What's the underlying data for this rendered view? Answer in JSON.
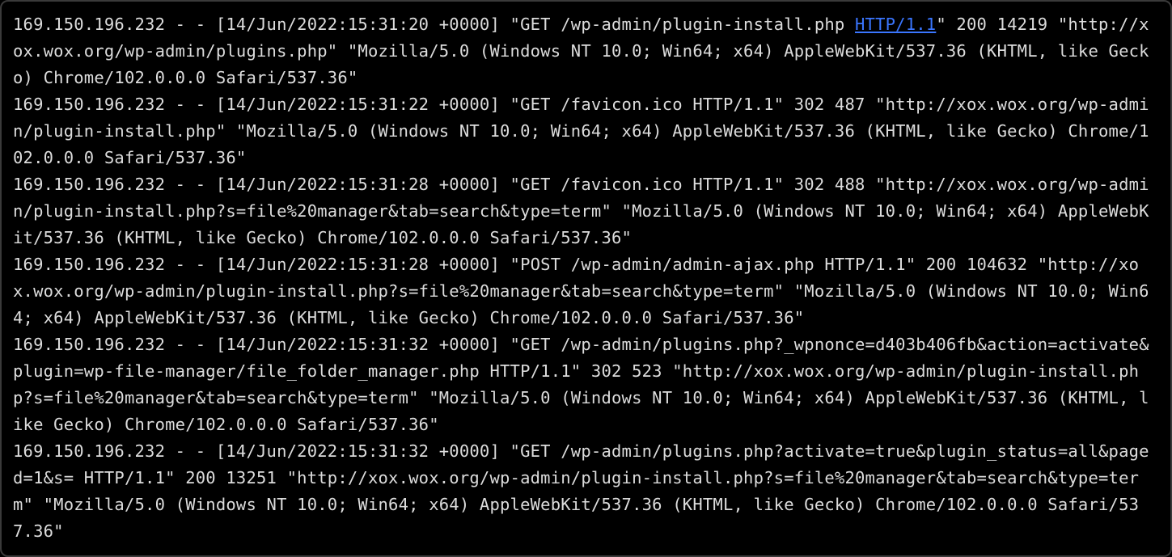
{
  "log": {
    "entries": [
      {
        "pre": "169.150.196.232 - - [14/Jun/2022:15:31:20 +0000] \"GET /wp-admin/plugin-install.php ",
        "link": "HTTP/1.1",
        "post": "\" 200 14219 \"http://xox.wox.org/wp-admin/plugins.php\" \"Mozilla/5.0 (Windows NT 10.0; Win64; x64) AppleWebKit/537.36 (KHTML, like Gecko) Chrome/102.0.0.0 Safari/537.36\""
      },
      {
        "pre": "169.150.196.232 - - [14/Jun/2022:15:31:22 +0000] \"GET /favicon.ico HTTP/1.1\" 302 487 \"http://xox.wox.org/wp-admin/plugin-install.php\" \"Mozilla/5.0 (Windows NT 10.0; Win64; x64) AppleWebKit/537.36 (KHTML, like Gecko) Chrome/102.0.0.0 Safari/537.36\"",
        "link": "",
        "post": ""
      },
      {
        "pre": "169.150.196.232 - - [14/Jun/2022:15:31:28 +0000] \"GET /favicon.ico HTTP/1.1\" 302 488 \"http://xox.wox.org/wp-admin/plugin-install.php?s=file%20manager&tab=search&type=term\" \"Mozilla/5.0 (Windows NT 10.0; Win64; x64) AppleWebKit/537.36 (KHTML, like Gecko) Chrome/102.0.0.0 Safari/537.36\"",
        "link": "",
        "post": ""
      },
      {
        "pre": "169.150.196.232 - - [14/Jun/2022:15:31:28 +0000] \"POST /wp-admin/admin-ajax.php HTTP/1.1\" 200 104632 \"http://xox.wox.org/wp-admin/plugin-install.php?s=file%20manager&tab=search&type=term\" \"Mozilla/5.0 (Windows NT 10.0; Win64; x64) AppleWebKit/537.36 (KHTML, like Gecko) Chrome/102.0.0.0 Safari/537.36\"",
        "link": "",
        "post": ""
      },
      {
        "pre": "169.150.196.232 - - [14/Jun/2022:15:31:32 +0000] \"GET /wp-admin/plugins.php?_wpnonce=d403b406fb&action=activate&plugin=wp-file-manager/file_folder_manager.php HTTP/1.1\" 302 523 \"http://xox.wox.org/wp-admin/plugin-install.php?s=file%20manager&tab=search&type=term\" \"Mozilla/5.0 (Windows NT 10.0; Win64; x64) AppleWebKit/537.36 (KHTML, like Gecko) Chrome/102.0.0.0 Safari/537.36\"",
        "link": "",
        "post": ""
      },
      {
        "pre": "169.150.196.232 - - [14/Jun/2022:15:31:32 +0000] \"GET /wp-admin/plugins.php?activate=true&plugin_status=all&paged=1&s= HTTP/1.1\" 200 13251 \"http://xox.wox.org/wp-admin/plugin-install.php?s=file%20manager&tab=search&type=term\" \"Mozilla/5.0 (Windows NT 10.0; Win64; x64) AppleWebKit/537.36 (KHTML, like Gecko) Chrome/102.0.0.0 Safari/537.36\"",
        "link": "",
        "post": ""
      }
    ]
  }
}
